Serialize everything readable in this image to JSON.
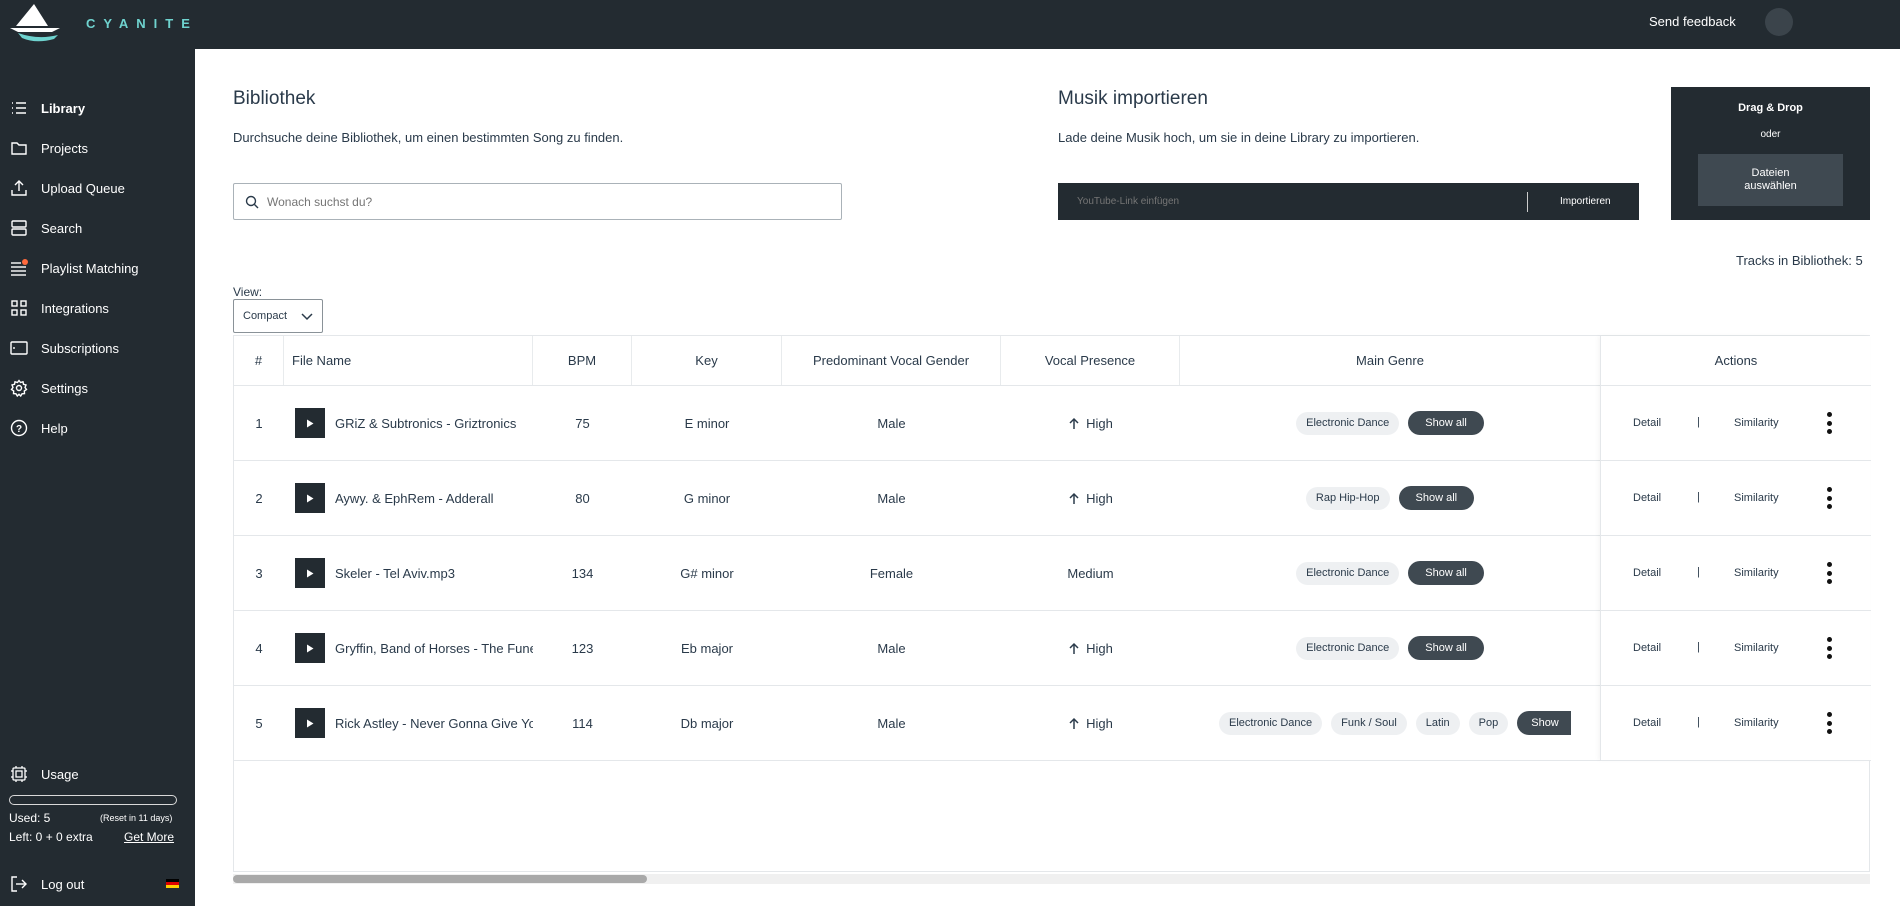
{
  "app": {
    "brand": "CYANITE",
    "send_feedback": "Send feedback"
  },
  "sidebar": {
    "items": [
      {
        "label": "Library",
        "icon": "list-icon"
      },
      {
        "label": "Projects",
        "icon": "folder-icon"
      },
      {
        "label": "Upload Queue",
        "icon": "upload-icon"
      },
      {
        "label": "Search",
        "icon": "search-stack-icon"
      },
      {
        "label": "Playlist Matching",
        "icon": "playlist-icon"
      },
      {
        "label": "Integrations",
        "icon": "grid-icon"
      },
      {
        "label": "Subscriptions",
        "icon": "card-icon"
      },
      {
        "label": "Settings",
        "icon": "gear-icon"
      },
      {
        "label": "Help",
        "icon": "help-icon"
      }
    ],
    "usage": {
      "label": "Usage",
      "used": "Used: 5",
      "reset": "(Reset in 11 days)",
      "left": "Left: 0 + 0 extra",
      "get_more": "Get More",
      "fill_fraction": 0
    },
    "logout": "Log out"
  },
  "library": {
    "title": "Bibliothek",
    "subtitle": "Durchsuche deine Bibliothek, um einen bestimmten Song zu finden.",
    "search_placeholder": "Wonach suchst du?"
  },
  "import": {
    "title": "Musik importieren",
    "subtitle": "Lade deine Musik hoch, um sie in deine Library zu importieren.",
    "youtube_placeholder": "YouTube-Link einfügen",
    "import_button": "Importieren",
    "dnd_title": "Drag & Drop",
    "dnd_or": "oder",
    "dnd_button_line1": "Dateien",
    "dnd_button_line2": "auswählen"
  },
  "tracks_count": "Tracks in Bibliothek: 5",
  "view": {
    "label": "View:",
    "selected": "Compact"
  },
  "table": {
    "headers": {
      "num": "#",
      "file": "File Name",
      "bpm": "BPM",
      "key": "Key",
      "gender": "Predominant Vocal Gender",
      "presence": "Vocal Presence",
      "genre": "Main Genre",
      "actions": "Actions"
    },
    "show_all": "Show all",
    "show_all_cut": "Show",
    "detail": "Detail",
    "divider": "|",
    "similarity": "Similarity",
    "rows": [
      {
        "num": "1",
        "file": "GRiZ & Subtronics - Griztronics",
        "bpm": "75",
        "key": "E minor",
        "gender": "Male",
        "presence": "High",
        "presence_arrow": true,
        "genres": [
          "Electronic Dance"
        ]
      },
      {
        "num": "2",
        "file": "Aywy. & EphRem - Adderall",
        "bpm": "80",
        "key": "G minor",
        "gender": "Male",
        "presence": "High",
        "presence_arrow": true,
        "genres": [
          "Rap Hip-Hop"
        ]
      },
      {
        "num": "3",
        "file": "Skeler - Tel Aviv.mp3",
        "bpm": "134",
        "key": "G# minor",
        "gender": "Female",
        "presence": "Medium",
        "presence_arrow": false,
        "genres": [
          "Electronic Dance"
        ]
      },
      {
        "num": "4",
        "file": "Gryffin, Band of Horses - The Funeral",
        "bpm": "123",
        "key": "Eb major",
        "gender": "Male",
        "presence": "High",
        "presence_arrow": true,
        "genres": [
          "Electronic Dance"
        ]
      },
      {
        "num": "5",
        "file": "Rick Astley - Never Gonna Give You Up",
        "bpm": "114",
        "key": "Db major",
        "gender": "Male",
        "presence": "High",
        "presence_arrow": true,
        "genres": [
          "Electronic Dance",
          "Funk / Soul",
          "Latin",
          "Pop"
        ]
      }
    ]
  }
}
